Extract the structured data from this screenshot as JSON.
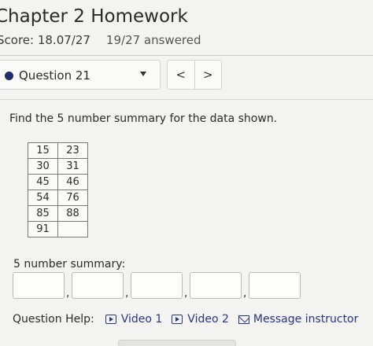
{
  "header": {
    "title": "Chapter 2 Homework",
    "score": "Score: 18.07/27",
    "answered": "19/27 answered"
  },
  "question_nav": {
    "selected": "Question 21",
    "prev_label": "<",
    "next_label": ">"
  },
  "question": {
    "prompt": "Find the 5 number summary for the data shown.",
    "table": [
      [
        "15",
        "23"
      ],
      [
        "30",
        "31"
      ],
      [
        "45",
        "46"
      ],
      [
        "54",
        "76"
      ],
      [
        "85",
        "88"
      ],
      [
        "91",
        ""
      ]
    ],
    "summary_label": "5 number summary:",
    "answers": [
      "",
      "",
      "",
      "",
      ""
    ],
    "separator": ","
  },
  "help": {
    "label": "Question Help:",
    "video1": "Video 1",
    "video2": "Video 2",
    "message": "Message instructor"
  },
  "colors": {
    "link": "#2a3580",
    "dot": "#1f2d6b"
  }
}
